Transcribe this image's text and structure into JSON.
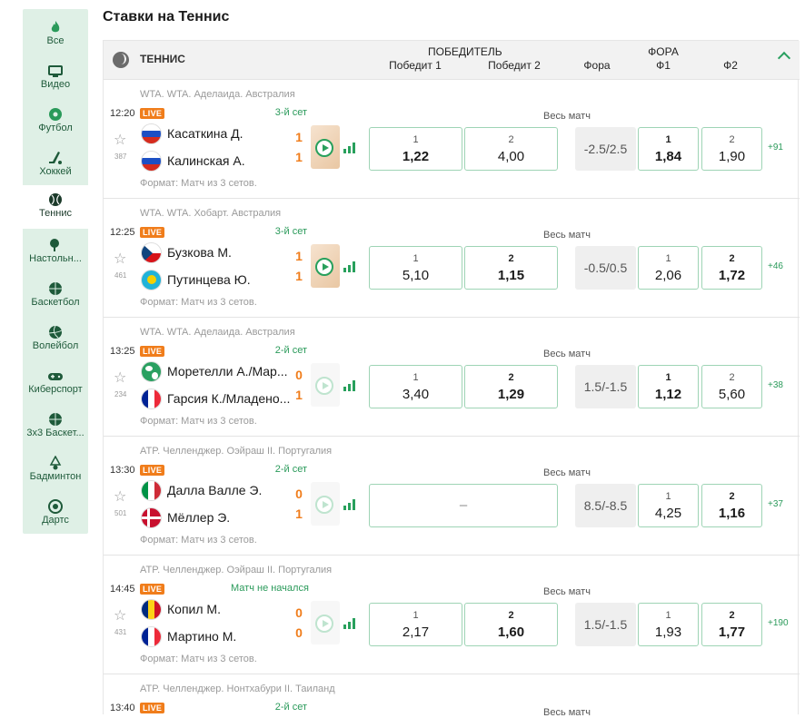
{
  "page": {
    "title": "Ставки на Теннис"
  },
  "sidebar": {
    "items": [
      {
        "label": "Все",
        "icon": "fire-icon",
        "active": false
      },
      {
        "label": "Видео",
        "icon": "tv-icon",
        "active": false
      },
      {
        "label": "Футбол",
        "icon": "soccer-ball-icon",
        "active": false
      },
      {
        "label": "Хоккей",
        "icon": "hockey-stick-icon",
        "active": false
      },
      {
        "label": "Теннис",
        "icon": "tennis-ball-icon",
        "active": true
      },
      {
        "label": "Настольн...",
        "icon": "table-tennis-icon",
        "active": false
      },
      {
        "label": "Баскетбол",
        "icon": "basketball-icon",
        "active": false
      },
      {
        "label": "Волейбол",
        "icon": "volleyball-icon",
        "active": false
      },
      {
        "label": "Киберспорт",
        "icon": "gamepad-icon",
        "active": false
      },
      {
        "label": "3x3 Баскет...",
        "icon": "basketball-icon",
        "active": false
      },
      {
        "label": "Бадминтон",
        "icon": "shuttlecock-icon",
        "active": false
      },
      {
        "label": "Дартс",
        "icon": "target-icon",
        "active": false
      }
    ]
  },
  "header": {
    "sport": "ТЕННИС",
    "winner_group": "ПОБЕДИТЕЛЬ",
    "win1": "Победит 1",
    "win2": "Победит 2",
    "fora": "Фора",
    "fora_group": "ФОРА",
    "f1": "Ф1",
    "f2": "Ф2"
  },
  "colors": {
    "accent": "#2aa061",
    "live": "#f07d1b",
    "sidebar_bg": "#dff0e6",
    "odd_border": "#9ed4b5"
  },
  "matches": [
    {
      "league": "WTA. WTA. Аделаида. Австралия",
      "time": "12:20",
      "live": "LIVE",
      "status": "3-й сет",
      "id": "387",
      "p1": {
        "name": "Касаткина Д.",
        "score": "1",
        "flag": "ru"
      },
      "p2": {
        "name": "Калинская А.",
        "score": "1",
        "flag": "ru"
      },
      "format": "Формат: Матч из 3 сетов.",
      "whole": "Весь матч",
      "w1": {
        "label": "1",
        "value": "1,22"
      },
      "w2": {
        "label": "2",
        "value": "4,00"
      },
      "fora": "-2.5/2.5",
      "f1": {
        "label": "1",
        "value": "1,84"
      },
      "f2": {
        "label": "2",
        "value": "1,90"
      },
      "more": "+91"
    },
    {
      "league": "WTA. WTA. Хобарт. Австралия",
      "time": "12:25",
      "live": "LIVE",
      "status": "3-й сет",
      "id": "461",
      "p1": {
        "name": "Бузкова М.",
        "score": "1",
        "flag": "cz"
      },
      "p2": {
        "name": "Путинцева Ю.",
        "score": "1",
        "flag": "kz"
      },
      "format": "Формат: Матч из 3 сетов.",
      "whole": "Весь матч",
      "w1": {
        "label": "1",
        "value": "5,10"
      },
      "w2": {
        "label": "2",
        "value": "1,15"
      },
      "fora": "-0.5/0.5",
      "f1": {
        "label": "1",
        "value": "2,06"
      },
      "f2": {
        "label": "2",
        "value": "1,72"
      },
      "more": "+46"
    },
    {
      "league": "WTA. WTA. Аделаида. Австралия",
      "time": "13:25",
      "live": "LIVE",
      "status": "2-й сет",
      "id": "234",
      "p1": {
        "name": "Моретелли А./Мар...",
        "score": "0",
        "flag": "world"
      },
      "p2": {
        "name": "Гарсия К./Младено...",
        "score": "1",
        "flag": "fr"
      },
      "format": "Формат: Матч из 3 сетов.",
      "whole": "Весь матч",
      "w1": {
        "label": "1",
        "value": "3,40"
      },
      "w2": {
        "label": "2",
        "value": "1,29"
      },
      "fora": "1.5/-1.5",
      "f1": {
        "label": "1",
        "value": "1,12"
      },
      "f2": {
        "label": "2",
        "value": "5,60"
      },
      "more": "+38"
    },
    {
      "league": "ATP. Челленджер. Оэйраш II. Португалия",
      "time": "13:30",
      "live": "LIVE",
      "status": "2-й сет",
      "id": "501",
      "p1": {
        "name": "Далла Валле Э.",
        "score": "0",
        "flag": "it"
      },
      "p2": {
        "name": "Мёллер Э.",
        "score": "1",
        "flag": "dk"
      },
      "format": "Формат: Матч из 3 сетов.",
      "whole": "Весь матч",
      "winner_empty": "–",
      "fora": "8.5/-8.5",
      "f1": {
        "label": "1",
        "value": "4,25"
      },
      "f2": {
        "label": "2",
        "value": "1,16"
      },
      "more": "+37"
    },
    {
      "league": "ATP. Челленджер. Оэйраш II. Португалия",
      "time": "14:45",
      "live": "LIVE",
      "status": "Матч не начался",
      "id": "431",
      "p1": {
        "name": "Копил М.",
        "score": "0",
        "flag": "ro"
      },
      "p2": {
        "name": "Мартино М.",
        "score": "0",
        "flag": "fr"
      },
      "format": "Формат: Матч из 3 сетов.",
      "whole": "Весь матч",
      "w1": {
        "label": "1",
        "value": "2,17"
      },
      "w2": {
        "label": "2",
        "value": "1,60"
      },
      "fora": "1.5/-1.5",
      "f1": {
        "label": "1",
        "value": "1,93"
      },
      "f2": {
        "label": "2",
        "value": "1,77"
      },
      "more": "+190"
    },
    {
      "league": "ATP. Челленджер. Нонтхабури II. Таиланд",
      "time": "13:40",
      "live": "LIVE",
      "status": "2-й сет",
      "whole": "Весь матч"
    }
  ]
}
